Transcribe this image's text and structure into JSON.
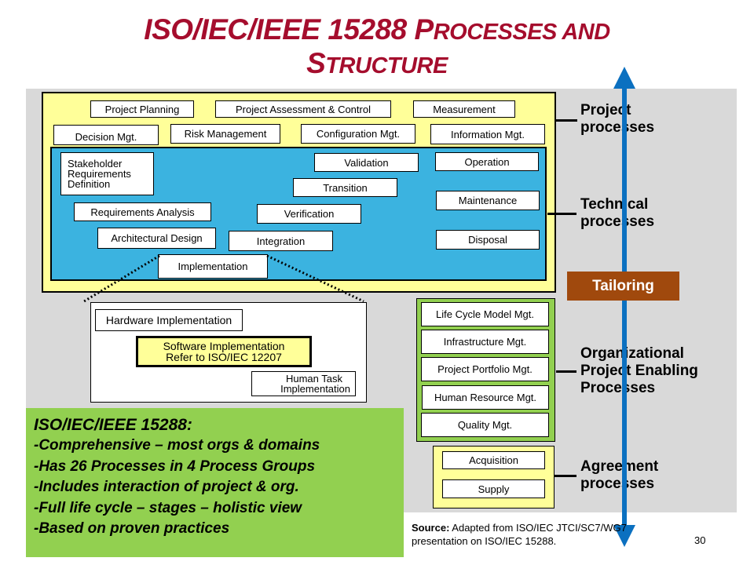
{
  "title": {
    "line1_prefix": "ISO/IEC/IEEE 15288 P",
    "line1_sc": "ROCESSES AND",
    "line2_prefix": "S",
    "line2_sc": "TRUCTURE"
  },
  "project_processes": [
    "Project Planning",
    "Project Assessment & Control",
    "Measurement",
    "Decision Mgt.",
    "Risk Management",
    "Configuration Mgt.",
    "Information Mgt."
  ],
  "technical_processes": {
    "stakeholder": [
      "Stakeholder",
      "Requirements",
      "Definition"
    ],
    "requirements_analysis": "Requirements Analysis",
    "architectural_design": "Architectural Design",
    "implementation": "Implementation",
    "integration": "Integration",
    "verification": "Verification",
    "transition": "Transition",
    "validation": "Validation",
    "operation": "Operation",
    "maintenance": "Maintenance",
    "disposal": "Disposal"
  },
  "implementation_detail": {
    "hardware": "Hardware Implementation",
    "software_line1": "Software Implementation",
    "software_line2": "Refer to ISO/IEC 12207",
    "human_line1": "Human Task",
    "human_line2": "Implementation"
  },
  "organizational_processes": [
    "Life Cycle Model Mgt.",
    "Infrastructure Mgt.",
    "Project Portfolio Mgt.",
    "Human Resource Mgt.",
    "Quality Mgt."
  ],
  "agreement_processes": [
    "Acquisition",
    "Supply"
  ],
  "group_labels": {
    "project": [
      "Project",
      "processes"
    ],
    "technical": [
      "Technical",
      "processes"
    ],
    "organizational": [
      "Organizational",
      "Project Enabling",
      "Processes"
    ],
    "agreement": [
      "Agreement",
      "processes"
    ]
  },
  "tailoring_label": "Tailoring",
  "summary": {
    "heading": "ISO/IEC/IEEE 15288:",
    "items": [
      "-Comprehensive – most orgs & domains",
      "-Has 26 Processes in 4 Process Groups",
      "-Includes interaction of project & org.",
      "-Full life cycle – stages – holistic view",
      "-Based on proven practices"
    ]
  },
  "source": {
    "label": "Source:",
    "text_line1": " Adapted from ISO/IEC  JTCI/SC7/WG7",
    "text_line2": "presentation on ISO/IEC 15288."
  },
  "page_number": "30",
  "colors": {
    "title": "#a50d2d",
    "project_bg": "#ffff99",
    "technical_bg": "#3bb3e0",
    "organizational_bg": "#92d050",
    "tailoring_bg": "#a0490d",
    "arrow": "#0b70c0"
  }
}
